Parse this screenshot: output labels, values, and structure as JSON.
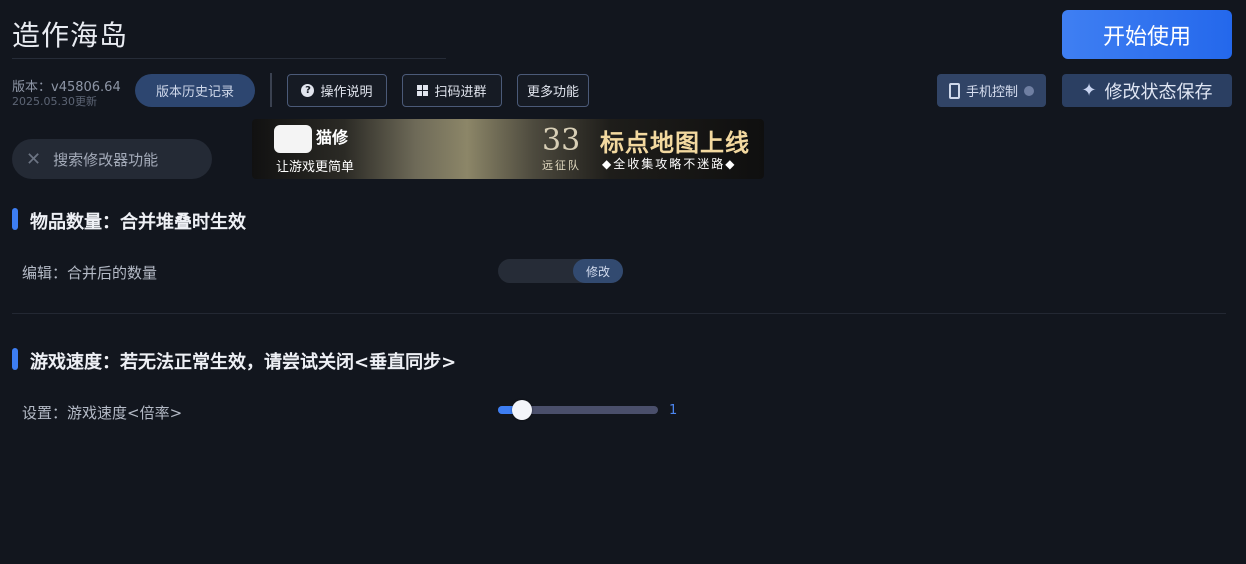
{
  "header": {
    "title": "造作海岛",
    "start_label": "开始使用",
    "version": "版本：v45806.64",
    "version_date": "2025.05.30更新",
    "history_label": "版本历史记录",
    "help_label": "操作说明",
    "scan_label": "扫码进群",
    "more_label": "更多功能",
    "phone_label": "手机控制",
    "save_label": "修改状态保存"
  },
  "search": {
    "placeholder": "搜索修改器功能"
  },
  "banner": {
    "brand": "猫修",
    "slogan": "让游戏更简单",
    "number": "33",
    "team": "远征队",
    "headline": "标点地图上线",
    "tagline": "◆全收集攻略不迷路◆"
  },
  "sections": [
    {
      "title": "物品数量：合并堆叠时生效",
      "label": "编辑：合并后的数量",
      "button": "修改"
    },
    {
      "title": "游戏速度：若无法正常生效，请尝试关闭<垂直同步>",
      "label": "设置：游戏速度<倍率>",
      "value": "1",
      "slider_fraction": 0.15
    }
  ],
  "colors": {
    "accent": "#3d7ef3",
    "background": "#12161e"
  },
  "icons": [
    "question-circle-icon",
    "qr-grid-icon",
    "phone-icon",
    "chevron-circle-icon",
    "sparkle-icon",
    "tools-icon"
  ]
}
